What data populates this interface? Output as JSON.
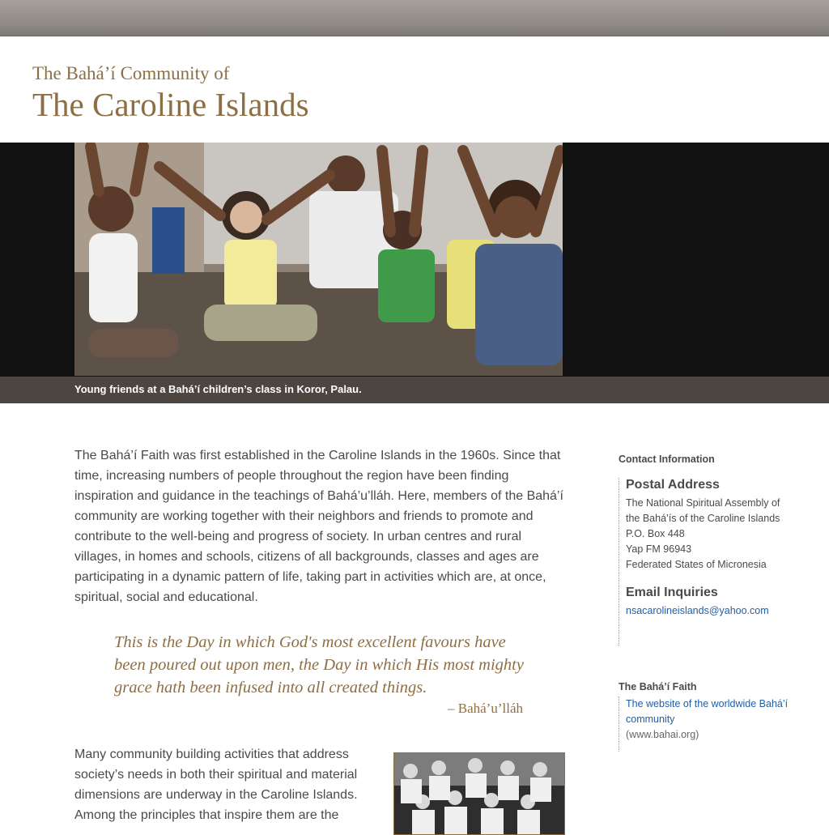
{
  "header": {
    "title_line1": "The Bahá’í Community of",
    "title_line2": "The Caroline Islands"
  },
  "hero": {
    "caption": "Young friends at a Bahá’í children’s class in Koror, Palau."
  },
  "main": {
    "paragraph1": "The Bahá’í Faith was first established in the Caroline Islands in the 1960s. Since that time, increasing numbers of people throughout the region have been finding inspiration and guidance in the teachings of Bahá’u’lláh. Here, members of the Bahá’í community are working together with their neighbors and friends to promote and contribute to the well-being and progress of society. In urban centres and rural villages, in homes and schools, citizens of all backgrounds, classes and ages are participating in a dynamic pattern of life, taking part in activities which are, at once, spiritual, social and educational.",
    "quote": "This is the Day in which God's most excellent favours have been poured out upon men, the Day in which His most mighty grace hath been infused into all created things.",
    "quote_author": "– Bahá’u’lláh",
    "paragraph2": "Many community building activities that address society’s needs in both their spiritual and material dimensions are underway in the Caroline Islands. Among the principles that inspire them are the"
  },
  "sidebar": {
    "contact_heading": "Contact Information",
    "postal_heading": "Postal Address",
    "postal_lines": [
      "The National Spiritual Assembly of",
      "the Bahá’ís of the Caroline Islands",
      "P.O. Box 448",
      "Yap FM 96943",
      "Federated States of Micronesia"
    ],
    "email_heading": "Email Inquiries",
    "email": "nsacarolineislands@yahoo.com",
    "faith_heading": "The Bahá’í Faith",
    "faith_link_line1": "The website of the worldwide Bahá’í",
    "faith_link_line2": "community",
    "faith_url": "(www.bahai.org)"
  },
  "colors": {
    "title_brown": "#8d6f45",
    "caption_bar": "#4d4540",
    "link_blue": "#1f5fa8"
  }
}
